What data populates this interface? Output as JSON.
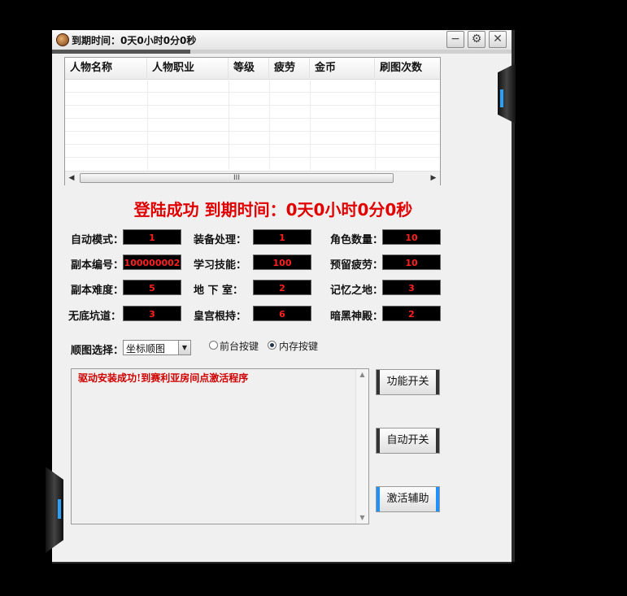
{
  "window": {
    "title": "到期时间：0天0小时0分0秒",
    "buttons": {
      "minimize": "−",
      "settings": "⚙",
      "close": "✕"
    }
  },
  "table": {
    "columns": [
      "人物名称",
      "人物职业",
      "等级",
      "疲劳",
      "金币",
      "刷图次数"
    ],
    "rows": [],
    "scroll_thumb_label": "III"
  },
  "banner": "登陆成功  到期时间：0天0小时0分0秒",
  "settings": {
    "auto_mode": {
      "label": "自动模式：",
      "value": "1"
    },
    "equip_process": {
      "label": "装备处理：",
      "value": "1"
    },
    "char_count": {
      "label": "角色数量：",
      "value": "10"
    },
    "dungeon_id": {
      "label": "副本编号：",
      "value": "100000002"
    },
    "learn_skill": {
      "label": "学习技能：",
      "value": "100"
    },
    "reserve_fatigue": {
      "label": "预留疲劳：",
      "value": "10"
    },
    "dungeon_difficulty": {
      "label": "副本难度：",
      "value": "5"
    },
    "basement": {
      "label": "地  下  室：",
      "value": "2"
    },
    "memory_land": {
      "label": "记忆之地：",
      "value": "3"
    },
    "abyss": {
      "label": "无底坑道：",
      "value": "3"
    },
    "palace": {
      "label": "皇宫根持：",
      "value": "6"
    },
    "dark_temple": {
      "label": "暗黑神殿：",
      "value": "2"
    }
  },
  "route": {
    "label": "顺图选择：",
    "selected": "坐标顺图",
    "radio_front": "前台按键",
    "radio_memory": "内存按键",
    "selected_radio": "memory"
  },
  "log": {
    "text": "驱动安装成功!到赛利亚房间点激活程序"
  },
  "actions": {
    "function_toggle": "功能开关",
    "auto_toggle": "自动开关",
    "activate": "激活辅助"
  },
  "progress": 0.3
}
